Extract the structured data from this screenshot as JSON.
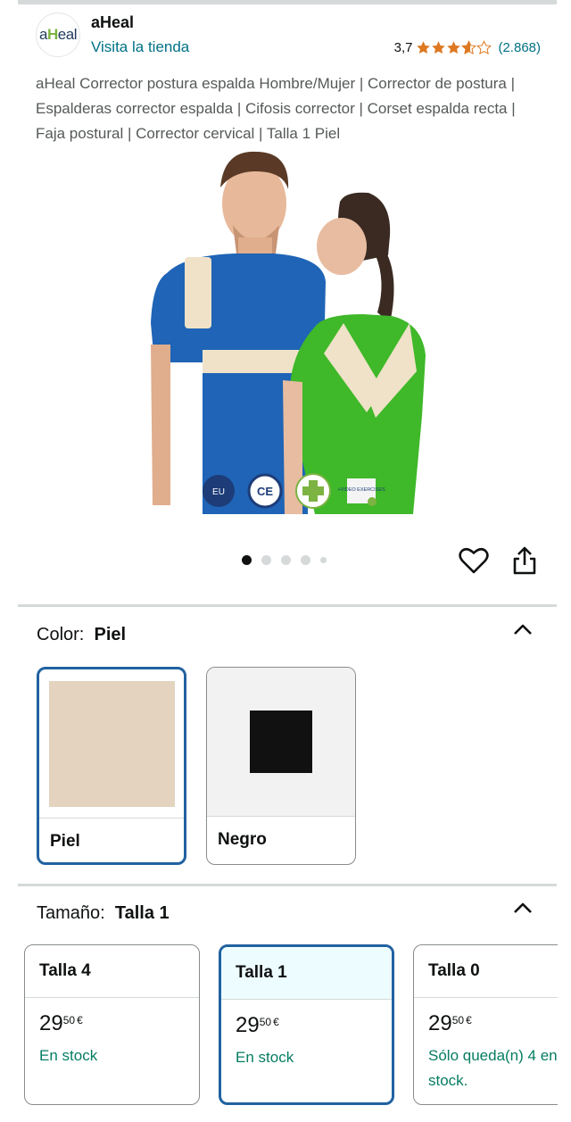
{
  "header": {
    "logo_text_a": "a",
    "logo_text_x": "H",
    "logo_text_b": "eal",
    "brand_name": "aHeal",
    "store_link": "Visita la tienda",
    "rating_value": "3,7",
    "rating_count": "(2.868)",
    "stars": 3.7
  },
  "product": {
    "title": "aHeal Corrector postura espalda Hombre/Mujer | Corrector de postura | Espalderas corrector espalda | Cifosis corrector | Corset espalda recta | Faja postural | Corrector cervical | Talla 1 Piel",
    "badges": [
      "EU",
      "CE",
      "+VIDEO EXERCISES"
    ],
    "image_count": 5,
    "active_image": 1
  },
  "color": {
    "label": "Color:",
    "selected": "Piel",
    "options": [
      {
        "label": "Piel",
        "swatch": "#e3d3bf",
        "selected": true
      },
      {
        "label": "Negro",
        "swatch": "#111111",
        "selected": false
      }
    ]
  },
  "size": {
    "label": "Tamaño:",
    "selected": "Talla 1",
    "options": [
      {
        "label": "Talla 4",
        "price_whole": "29",
        "price_frac": "50",
        "currency": "€",
        "stock": "En stock",
        "selected": false
      },
      {
        "label": "Talla 1",
        "price_whole": "29",
        "price_frac": "50",
        "currency": "€",
        "stock": "En stock",
        "selected": true
      },
      {
        "label": "Talla 0",
        "price_whole": "29",
        "price_frac": "50",
        "currency": "€",
        "stock": "Sólo queda(n) 4 en stock.",
        "selected": false
      }
    ]
  },
  "colors": {
    "link": "#007185",
    "selected_border": "#2162a1",
    "stock_green": "#067d62",
    "star_orange": "#de7921"
  }
}
